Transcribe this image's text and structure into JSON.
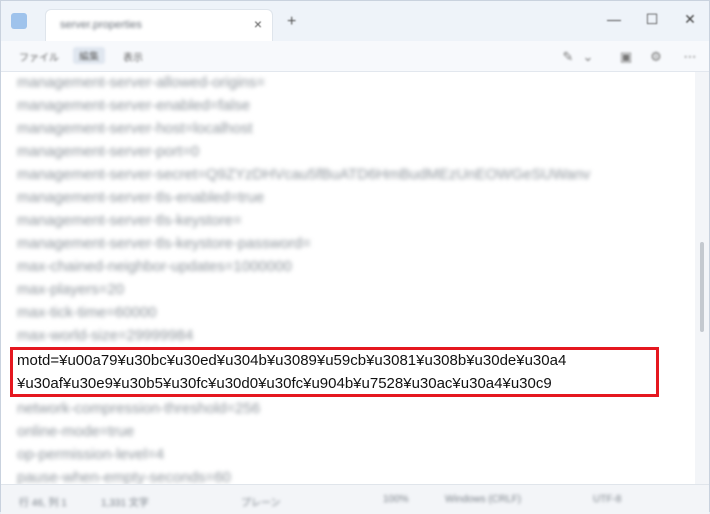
{
  "window": {
    "tab_title": "server.properties",
    "tab_close": "×",
    "new_tab": "+",
    "minimize": "—",
    "maximize": "☐",
    "close": "✕"
  },
  "menu": {
    "items": [
      "ファイル",
      "編集",
      "表示"
    ]
  },
  "toolbar": {
    "icons": [
      "format-icon",
      "dropdown-icon",
      "save-icon",
      "settings-icon",
      "more-icon"
    ]
  },
  "editor": {
    "lines_before": [
      "management-server-allowed-origins=",
      "management-server-enabled=false",
      "management-server-host=localhost",
      "management-server-port=0",
      "management-server-secret=Q9ZYzDHVcau5fBuATD6HmBudMEzUnEOWGeSUWanv",
      "management-server-tls-enabled=true",
      "management-server-tls-keystore=",
      "management-server-tls-keystore-password=",
      "max-chained-neighbor-updates=1000000",
      "max-players=20",
      "max-tick-time=60000",
      "max-world-size=29999984"
    ],
    "motd_lines": [
      "motd=¥u00a79¥u30bc¥u30ed¥u304b¥u3089¥u59cb¥u3081¥u308b¥u30de¥u30a4",
      "¥u30af¥u30e9¥u30b5¥u30fc¥u30d0¥u30fc¥u904b¥u7528¥u30ac¥u30a4¥u30c9"
    ],
    "lines_after": [
      "network-compression-threshold=256",
      "online-mode=true",
      "op-permission-level=4",
      "pause-when-empty-seconds=60"
    ],
    "highlight_color": "#e5171f"
  },
  "status": {
    "position": "行 46, 列 1",
    "chars": "1,331 文字",
    "plain": "プレーン",
    "zoom": "100%",
    "line_ending": "Windows (CRLF)",
    "encoding": "UTF-8"
  }
}
